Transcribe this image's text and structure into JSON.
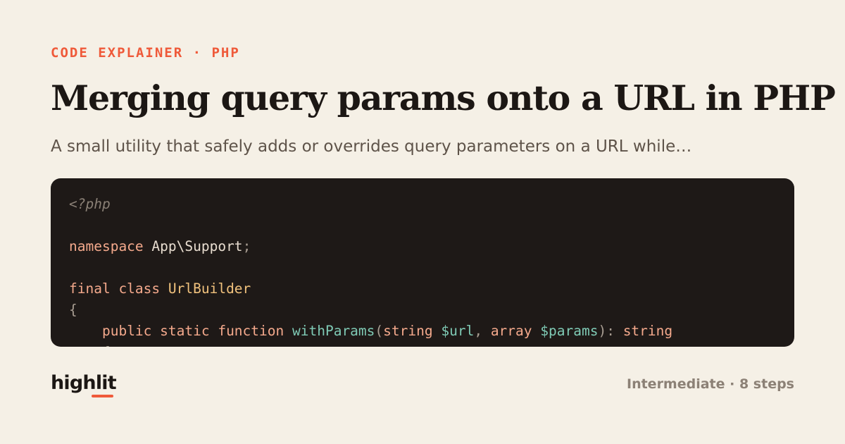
{
  "header": {
    "eyebrow": "CODE EXPLAINER · PHP",
    "title": "Merging query params onto a URL in PHP",
    "subtitle": "A small utility that safely adds or overrides query parameters on a URL while…"
  },
  "code": {
    "lines": [
      [
        {
          "text": "<?php",
          "kind": "comment"
        }
      ],
      [],
      [
        {
          "text": "namespace",
          "kind": "keyword"
        },
        {
          "text": " App\\Support",
          "kind": "plain"
        },
        {
          "text": ";",
          "kind": "punct"
        }
      ],
      [],
      [
        {
          "text": "final class",
          "kind": "keyword"
        },
        {
          "text": " ",
          "kind": "plain"
        },
        {
          "text": "UrlBuilder",
          "kind": "type"
        }
      ],
      [
        {
          "text": "{",
          "kind": "punct"
        }
      ],
      [
        {
          "text": "    ",
          "kind": "plain"
        },
        {
          "text": "public static function",
          "kind": "keyword"
        },
        {
          "text": " ",
          "kind": "plain"
        },
        {
          "text": "withParams",
          "kind": "function"
        },
        {
          "text": "(",
          "kind": "punct"
        },
        {
          "text": "string",
          "kind": "keyword"
        },
        {
          "text": " ",
          "kind": "plain"
        },
        {
          "text": "$url",
          "kind": "variable"
        },
        {
          "text": ", ",
          "kind": "punct"
        },
        {
          "text": "array",
          "kind": "keyword"
        },
        {
          "text": " ",
          "kind": "plain"
        },
        {
          "text": "$params",
          "kind": "variable"
        },
        {
          "text": "): ",
          "kind": "punct"
        },
        {
          "text": "string",
          "kind": "keyword"
        }
      ],
      [
        {
          "text": "    {",
          "kind": "punct"
        }
      ]
    ]
  },
  "footer": {
    "brand": "highlit",
    "meta": "Intermediate · 8 steps"
  },
  "colors": {
    "background": "#f5f0e6",
    "accent": "#ef5a3a",
    "code_background": "#1e1917"
  }
}
